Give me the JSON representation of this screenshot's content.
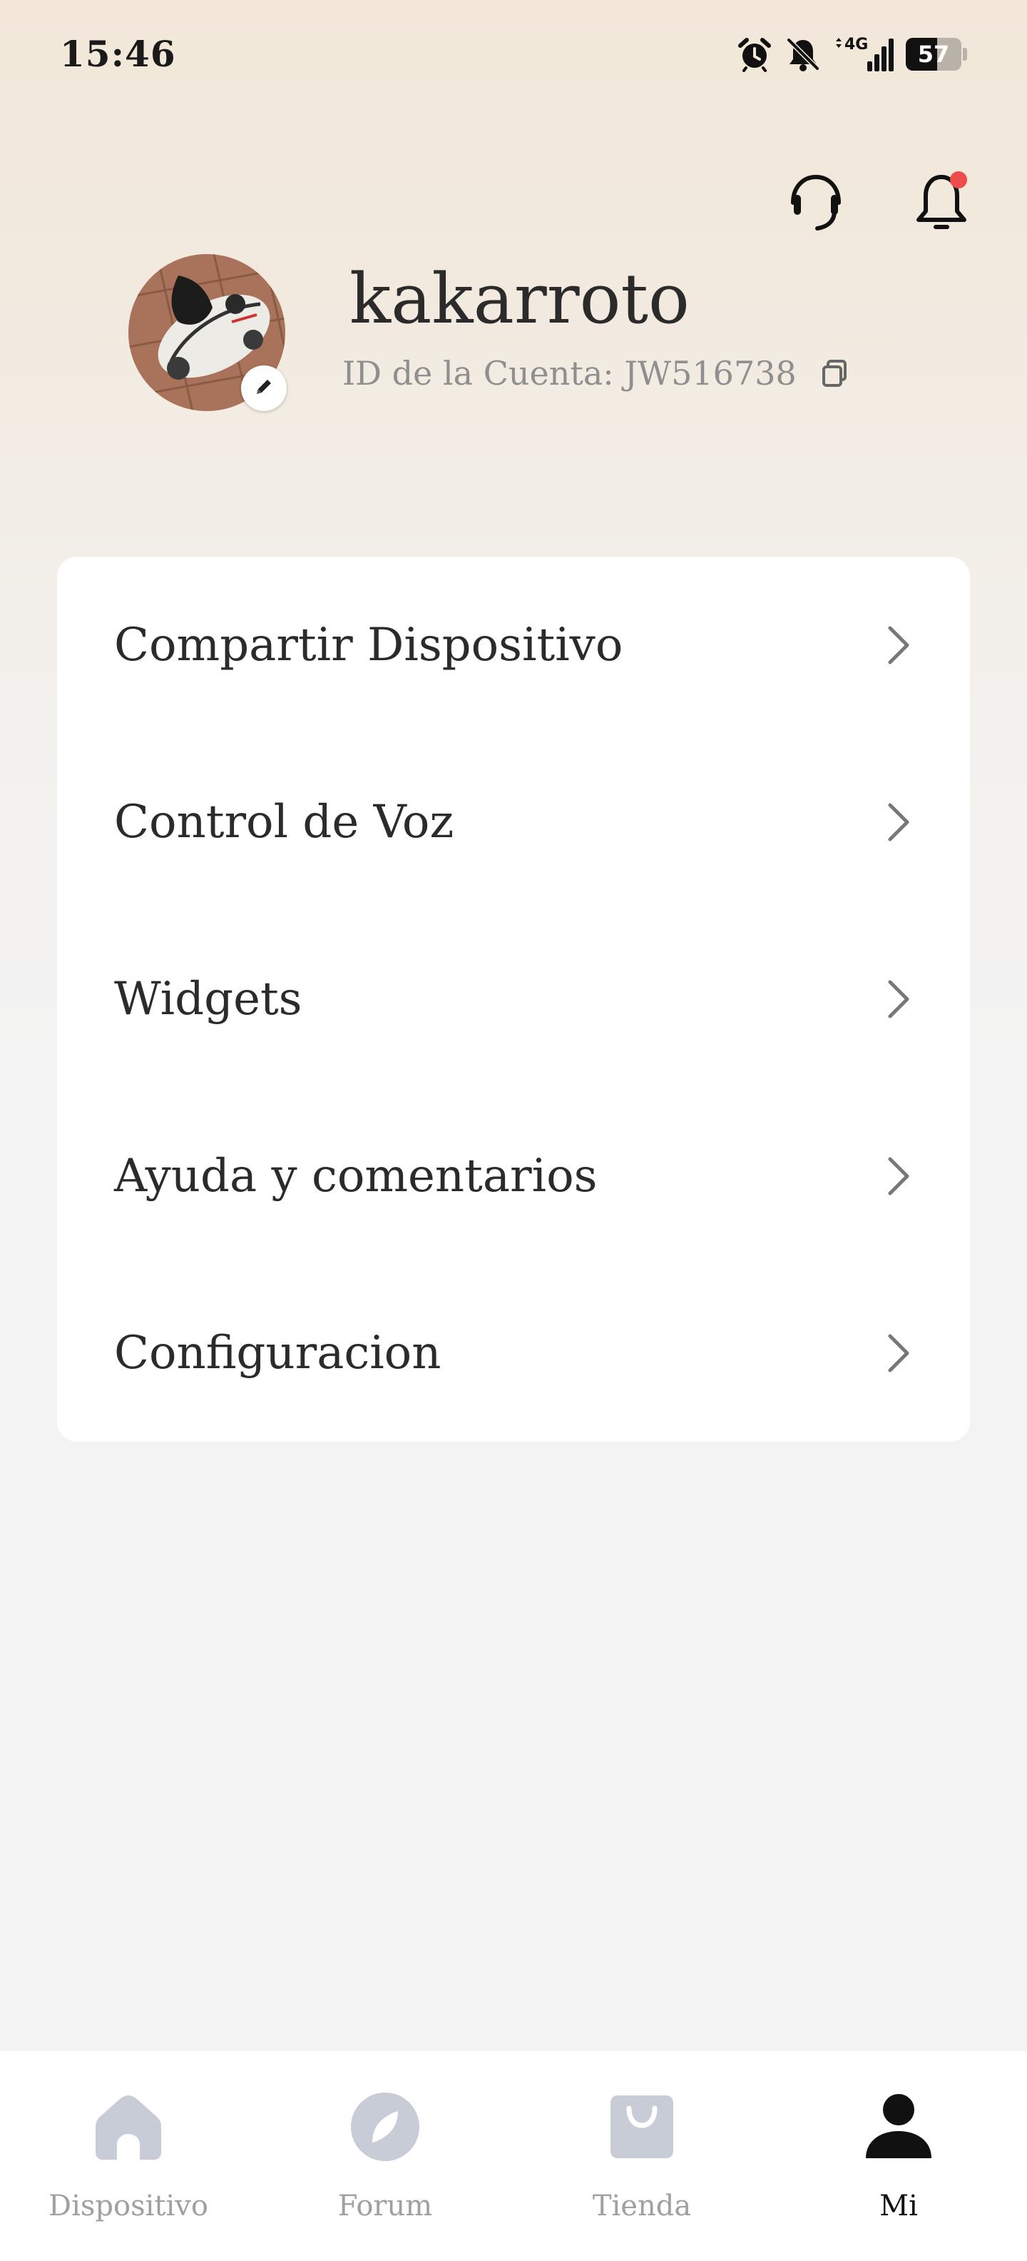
{
  "status_bar": {
    "time": "15:46",
    "icons": [
      "alarm-icon",
      "bell-muted-icon",
      "signal-4g-icon"
    ],
    "network": "4G",
    "battery": {
      "label": "57",
      "percent": 57
    }
  },
  "header": {
    "actions": [
      {
        "name": "support-headset-icon"
      },
      {
        "name": "notification-bell-icon",
        "has_badge": true,
        "badge_color": "#ee4b4b"
      }
    ]
  },
  "profile": {
    "username": "kakarroto",
    "account_id": "ID de la Cuenta: JW516738",
    "avatar_icon": "ride-on-car-photo",
    "edit_icon": "pencil-icon",
    "copy_icon": "copy-icon"
  },
  "menu": {
    "items": [
      {
        "label": "Compartir Dispositivo"
      },
      {
        "label": "Control de Voz"
      },
      {
        "label": "Widgets"
      },
      {
        "label": "Ayuda y comentarios"
      },
      {
        "label": "Configuracion"
      }
    ],
    "chevron_icon": "chevron-right-icon"
  },
  "bottom_nav": {
    "items": [
      {
        "label": "Dispositivo",
        "icon": "home-icon",
        "active": false
      },
      {
        "label": "Forum",
        "icon": "compass-icon",
        "active": false
      },
      {
        "label": "Tienda",
        "icon": "shopping-bag-icon",
        "active": false
      },
      {
        "label": "Mi",
        "icon": "person-icon",
        "active": true
      }
    ]
  },
  "colors": {
    "accent_badge": "#ee4b4b",
    "nav_inactive": "#c8ccd6",
    "nav_active": "#111111",
    "text_primary": "#2b2b2b",
    "text_secondary": "#8f8f8f"
  }
}
